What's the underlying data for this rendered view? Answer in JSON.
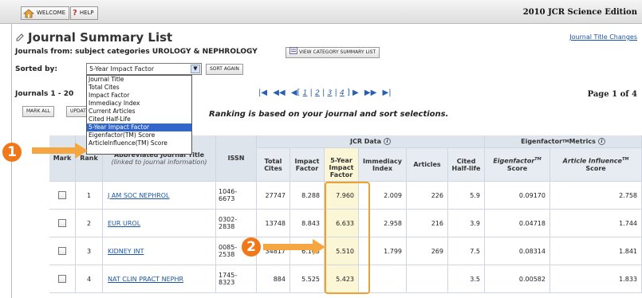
{
  "topbar": {
    "welcome_label": "WELCOME",
    "help_label": "HELP",
    "edition": "2010 JCR Science Edition"
  },
  "summary": {
    "title": "Journal Summary List",
    "title_link": "Journal Title Changes",
    "from_label": "Journals from:",
    "from_value": "subject categories UROLOGY & NEPHROLOGY",
    "view_category_label": "VIEW CATEGORY SUMMARY LIST",
    "sorted_label": "Sorted by:",
    "sort_selected": "5-Year Impact Factor",
    "sort_again_label": "SORT AGAIN",
    "sort_options": [
      "Journal Title",
      "Total Cites",
      "Impact Factor",
      "Immediacy Index",
      "Current Articles",
      "Cited Half-Life",
      "5-Year Impact Factor",
      "Eigenfactor(TM) Score",
      "ArticleInfluence(TM) Score"
    ],
    "journals_range": "Journals 1 - 20",
    "mark_all_label": "MARK ALL",
    "update_label": "UPDATE",
    "pager_first": "|◀",
    "pager_prev_many": "◀◀",
    "pager_prev": "◀",
    "pager_pages": [
      "1",
      "2",
      "3",
      "4"
    ],
    "pager_next": "▶",
    "pager_next_many": "▶▶",
    "pager_last": "▶|",
    "page_count": "Page 1 of 4",
    "ranking_note": "Ranking is based on your journal and sort selections."
  },
  "table": {
    "headers": {
      "mark": "Mark",
      "rank": "Rank",
      "title_main": "Abbreviated Journal Title",
      "title_sub": "(linked to journal information)",
      "issn": "ISSN",
      "jcr_group": "JCR Data",
      "eigen_group": "Eigenfactor",
      "eigen_group_sup": "TM",
      "eigen_group_tail": " Metrics",
      "total_cites": "Total Cites",
      "impact_factor": "Impact Factor",
      "five_year": "5-Year Impact Factor",
      "immediacy": "Immediacy Index",
      "articles": "Articles",
      "cited_half_life": "Cited Half-life",
      "eigen_score": "Eigenfactor",
      "eigen_score_sup": "TM",
      "eigen_score_tail": "Score",
      "article_influence": "Article Influence",
      "article_influence_sup": "TM",
      "article_influence_tail": "Score"
    },
    "rows": [
      {
        "rank": "1",
        "title": "J AM SOC NEPHROL",
        "issn1": "1046-",
        "issn2": "6673",
        "total_cites": "27747",
        "impact_factor": "8.288",
        "five_year": "7.960",
        "immediacy": "2.009",
        "articles": "226",
        "half_life": "5.9",
        "eigen": "0.09170",
        "influence": "2.758"
      },
      {
        "rank": "2",
        "title": "EUR UROL",
        "issn1": "0302-",
        "issn2": "2838",
        "total_cites": "13748",
        "impact_factor": "8.843",
        "five_year": "6.633",
        "immediacy": "2.958",
        "articles": "216",
        "half_life": "3.9",
        "eigen": "0.04718",
        "influence": "1.744"
      },
      {
        "rank": "3",
        "title": "KIDNEY INT",
        "issn1": "0085-",
        "issn2": "2538",
        "total_cites": "34817",
        "impact_factor": "6.105",
        "five_year": "5.510",
        "immediacy": "1.799",
        "articles": "269",
        "half_life": "7.5",
        "eigen": "0.08314",
        "influence": "1.841"
      },
      {
        "rank": "4",
        "title": "NAT CLIN PRACT NEPHR",
        "issn1": "1745-",
        "issn2": "8323",
        "total_cites": "884",
        "impact_factor": "5.525",
        "five_year": "5.423",
        "immediacy": "",
        "articles": "",
        "half_life": "3.5",
        "eigen": "0.00582",
        "influence": "1.833"
      }
    ]
  },
  "callouts": {
    "one": "1",
    "two": "2"
  },
  "colors": {
    "accent_orange": "#f07818",
    "highlight": "#fbf6d6",
    "link": "#1a55a8",
    "header_bg": "#dde4ec",
    "selected": "#3366cc"
  }
}
